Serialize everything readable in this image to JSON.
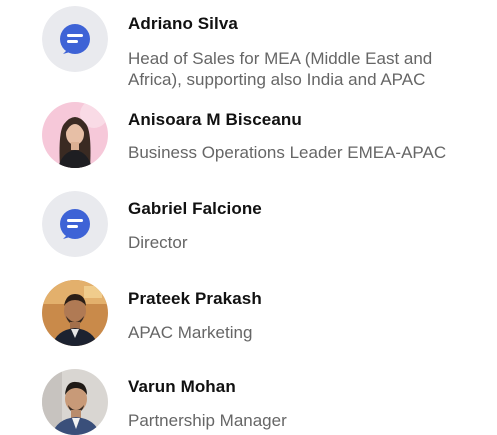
{
  "people": [
    {
      "name": "Adriano Silva",
      "title_lines": [
        "Head of Sales for MEA (Middle East and",
        "Africa), supporting also India and APAC"
      ],
      "avatar": "company-logo-icon"
    },
    {
      "name": "Anisoara M Bisceanu",
      "title_lines": [
        "Business Operations Leader EMEA-APAC"
      ],
      "avatar": "profile-photo"
    },
    {
      "name": "Gabriel Falcione",
      "title_lines": [
        "Director"
      ],
      "avatar": "company-logo-icon"
    },
    {
      "name": "Prateek Prakash",
      "title_lines": [
        "APAC Marketing"
      ],
      "avatar": "profile-photo"
    },
    {
      "name": "Varun Mohan",
      "title_lines": [
        "Partnership Manager"
      ],
      "avatar": "profile-photo"
    }
  ],
  "colors": {
    "logo_circle_bg": "#e9eaee",
    "logo_blue": "#3e63d6",
    "name_text": "#111111",
    "title_text": "#666666"
  }
}
